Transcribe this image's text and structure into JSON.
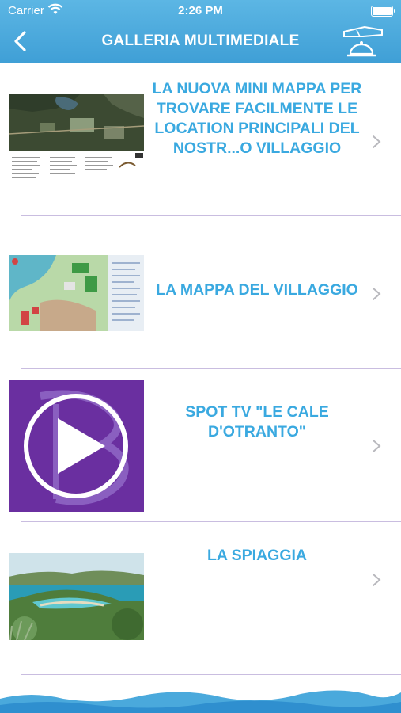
{
  "status_bar": {
    "carrier": "Carrier",
    "time": "2:26 PM"
  },
  "nav": {
    "title": "GALLERIA MULTIMEDIALE",
    "back_icon": "chevron-left-icon",
    "right_icon": "service-bell-icon"
  },
  "items": [
    {
      "title": "LA NUOVA MINI MAPPA PER TROVARE FACILMENTE LE LOCATION PRINCIPALI DEL NOSTR...O VILLAGGIO",
      "thumb": "aerial-map"
    },
    {
      "title": "LA MAPPA DEL VILLAGGIO",
      "thumb": "village-map"
    },
    {
      "title": "SPOT TV \"LE CALE D'OTRANTO\"",
      "thumb": "video-play"
    },
    {
      "title": "LA SPIAGGIA",
      "thumb": "beach-photo"
    }
  ],
  "colors": {
    "header": "#4aa9dc",
    "accent_text": "#3aa9e0",
    "separator": "#c9bde0",
    "video_bg": "#6a2fa0"
  }
}
